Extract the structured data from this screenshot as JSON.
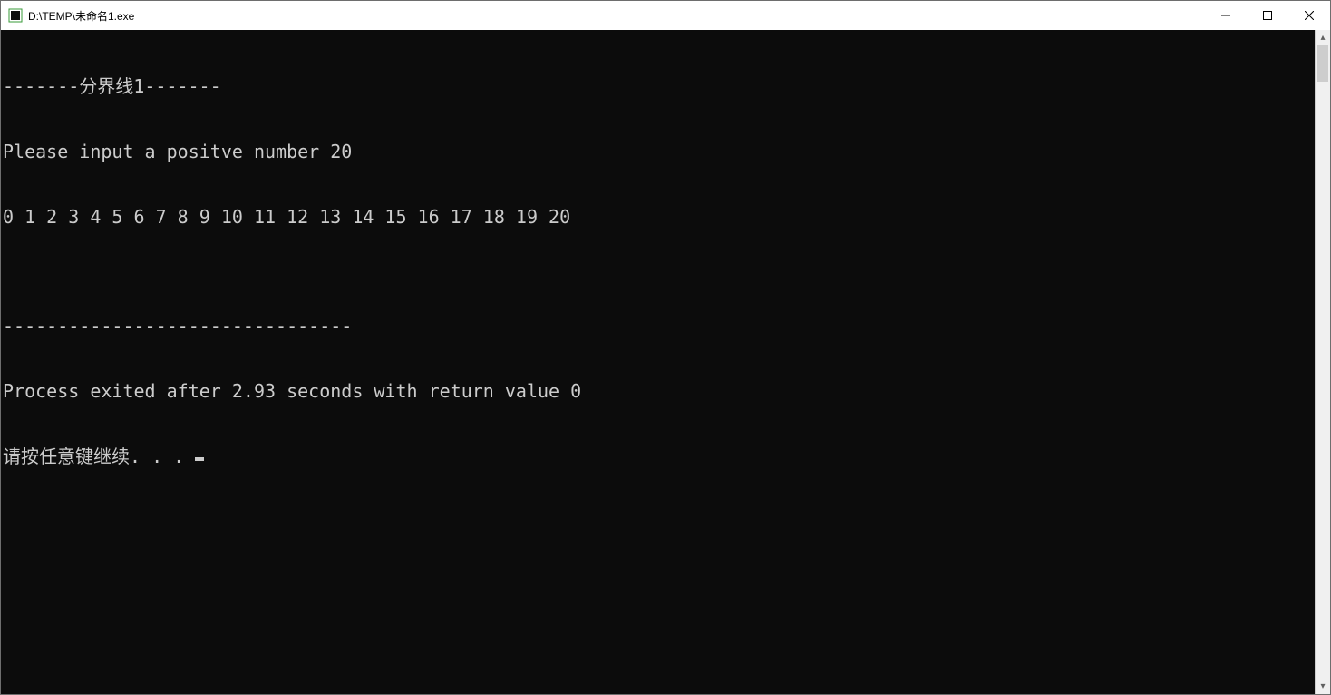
{
  "window": {
    "title": "D:\\TEMP\\未命名1.exe"
  },
  "console": {
    "lines": [
      "-------分界线1-------",
      "Please input a positve number 20",
      "0 1 2 3 4 5 6 7 8 9 10 11 12 13 14 15 16 17 18 19 20",
      "",
      "--------------------------------",
      "Process exited after 2.93 seconds with return value 0",
      "请按任意键继续. . . "
    ]
  },
  "scrollbar": {
    "up": "▴",
    "down": "▾"
  }
}
